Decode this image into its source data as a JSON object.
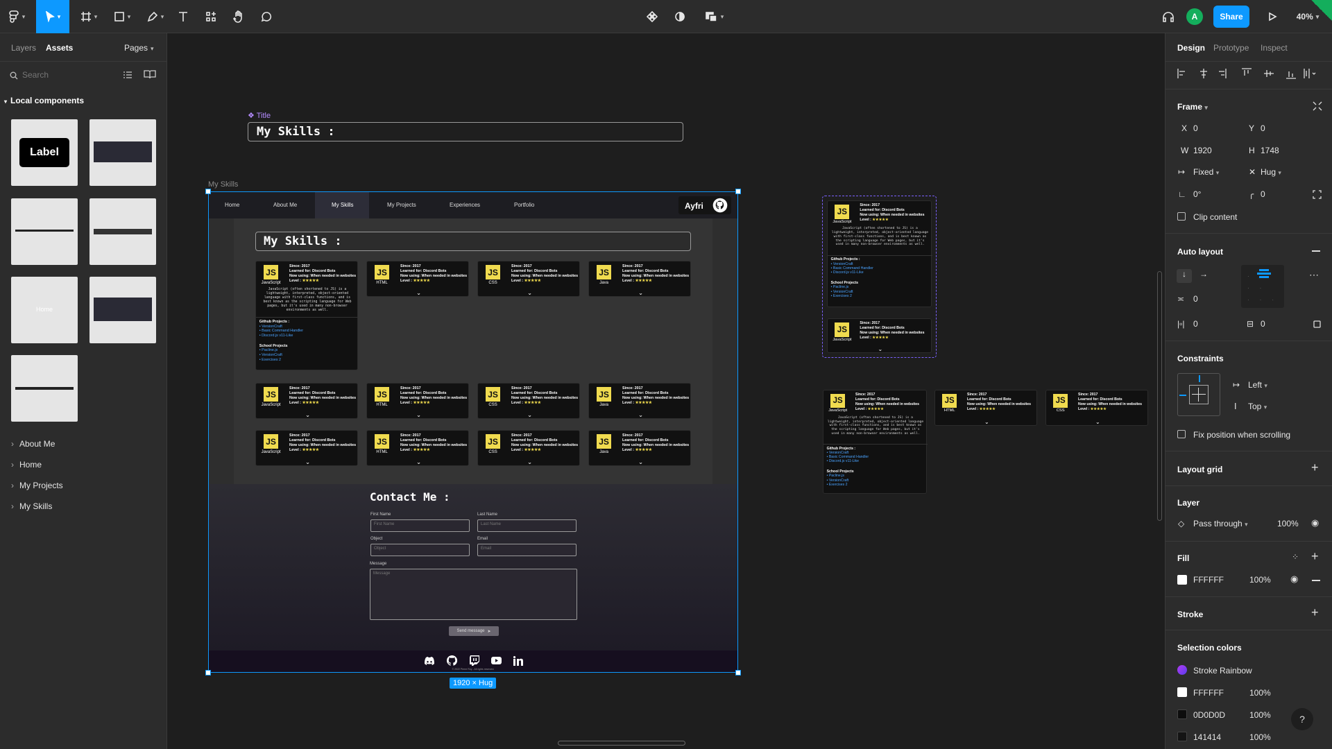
{
  "toolbar": {
    "share_label": "Share",
    "zoom": "40%",
    "avatar_initial": "A"
  },
  "left_panel": {
    "tabs": [
      "Layers",
      "Assets"
    ],
    "pages_label": "Pages",
    "search_placeholder": "Search",
    "local_components": "Local components",
    "label_component": "Label",
    "home_thumb": "Home",
    "tree": [
      "About Me",
      "Home",
      "My Projects",
      "My Skills"
    ]
  },
  "canvas": {
    "title_frame_label": "Title",
    "title_text": "My Skills :",
    "main_frame_label": "My Skills",
    "size_badge": "1920 × Hug",
    "site": {
      "nav": [
        "Home",
        "About Me",
        "My Skills",
        "My Projects",
        "Experiences",
        "Portfolio"
      ],
      "brand": "Ayfri",
      "section_title": "My Skills :",
      "cards": [
        {
          "lang": "JavaScript",
          "since": "Since: 2017",
          "learned": "Learned for: Discord Bots",
          "now": "Now using: When needed in websites",
          "level": "Level :"
        },
        {
          "lang": "HTML",
          "since": "Since: 2017",
          "learned": "Learned for: Discord Bots",
          "now": "Now using: When needed in websites",
          "level": "Level :"
        },
        {
          "lang": "CSS",
          "since": "Since: 2017",
          "learned": "Learned for: Discord Bots",
          "now": "Now using: When needed in websites",
          "level": "Level :"
        },
        {
          "lang": "Java",
          "since": "Since: 2017",
          "learned": "Learned for: Discord Bots",
          "now": "Now using: When needed in websites",
          "level": "Level :"
        }
      ],
      "js_badge": "JS",
      "stars": "★★★★★",
      "description": "JavaScript (often shortened to JS) is a lightweight, interpreted, object-oriented language with first-class functions, and is best known as the scripting language for Web pages, but it's used in many non-browser environments as well.",
      "github_projects_title": "Github Projects :",
      "github_projects": [
        "VersionCraft",
        "Basic Command Handler",
        "Discord.js v11-Like"
      ],
      "school_projects_title": "School Projects",
      "school_projects": [
        "Pacline.js",
        "VersionCraft",
        "Exercises 2"
      ],
      "contact_title": "Contact Me :",
      "first_name_label": "First Name",
      "first_name_placeholder": "First Name",
      "last_name_label": "Last Name",
      "last_name_placeholder": "Last Name",
      "object_label": "Object",
      "object_placeholder": "Object",
      "email_label": "Email",
      "email_placeholder": "Email",
      "message_label": "Message",
      "message_placeholder": "Message",
      "send_button": "Send message",
      "copyright": "© 2022 Pierre Roy - All rights reserved."
    }
  },
  "right_panel": {
    "tabs": [
      "Design",
      "Prototype",
      "Inspect"
    ],
    "frame_title": "Frame",
    "x_label": "X",
    "x": "0",
    "y_label": "Y",
    "y": "0",
    "w_label": "W",
    "w": "1920",
    "h_label": "H",
    "h": "1748",
    "width_mode": "Fixed",
    "height_mode": "Hug",
    "rotation": "0°",
    "radius": "0",
    "clip_content": "Clip content",
    "auto_layout": "Auto layout",
    "spacing": "0",
    "padding_h": "0",
    "padding_v": "0",
    "constraints": "Constraints",
    "constraint_h": "Left",
    "constraint_v": "Top",
    "fix_position": "Fix position when scrolling",
    "layout_grid": "Layout grid",
    "layer": "Layer",
    "blend": "Pass through",
    "layer_opacity": "100%",
    "fill": "Fill",
    "fill_hex": "FFFFFF",
    "fill_opacity": "100%",
    "stroke": "Stroke",
    "selection_colors": "Selection colors",
    "colors": [
      {
        "name": "Stroke Rainbow",
        "swatch": "#8a3cf0"
      },
      {
        "name": "FFFFFF",
        "opacity": "100%",
        "swatch": "#FFFFFF"
      },
      {
        "name": "0D0D0D",
        "opacity": "100%",
        "swatch": "#0D0D0D"
      },
      {
        "name": "141414",
        "opacity": "100%",
        "swatch": "#141414"
      }
    ],
    "help": "?"
  },
  "colors": {
    "accent": "#0d99ff",
    "canvas": "#1e1e1e",
    "panel": "#2c2c2c",
    "js_yellow": "#f0db4f",
    "avatar": "#14ae5c"
  }
}
